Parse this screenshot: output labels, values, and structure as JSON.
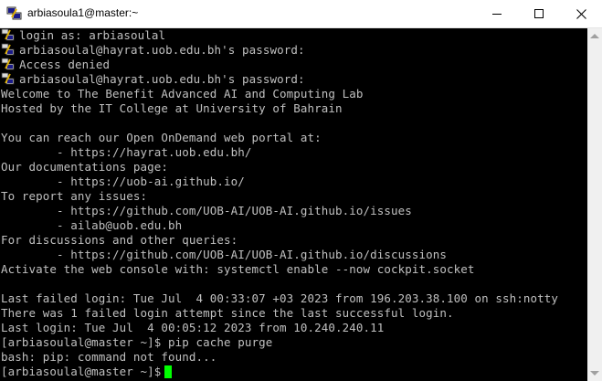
{
  "window": {
    "title": "arbiasoula1@master:~",
    "icon": "putty-terminal-icon"
  },
  "terminal": {
    "lines": [
      {
        "icon": true,
        "text": "login as: arbiasoulal"
      },
      {
        "icon": true,
        "text": "arbiasoulal@hayrat.uob.edu.bh's password:"
      },
      {
        "icon": true,
        "text": "Access denied"
      },
      {
        "icon": true,
        "text": "arbiasoulal@hayrat.uob.edu.bh's password:"
      },
      {
        "icon": false,
        "text": "Welcome to The Benefit Advanced AI and Computing Lab"
      },
      {
        "icon": false,
        "text": "Hosted by the IT College at University of Bahrain"
      },
      {
        "icon": false,
        "text": ""
      },
      {
        "icon": false,
        "text": "You can reach our Open OnDemand web portal at:"
      },
      {
        "icon": false,
        "text": "        - https://hayrat.uob.edu.bh/"
      },
      {
        "icon": false,
        "text": "Our documentations page:"
      },
      {
        "icon": false,
        "text": "        - https://uob-ai.github.io/"
      },
      {
        "icon": false,
        "text": "To report any issues:"
      },
      {
        "icon": false,
        "text": "        - https://github.com/UOB-AI/UOB-AI.github.io/issues"
      },
      {
        "icon": false,
        "text": "        - ailab@uob.edu.bh"
      },
      {
        "icon": false,
        "text": "For discussions and other queries:"
      },
      {
        "icon": false,
        "text": "        - https://github.com/UOB-AI/UOB-AI.github.io/discussions"
      },
      {
        "icon": false,
        "text": "Activate the web console with: systemctl enable --now cockpit.socket"
      },
      {
        "icon": false,
        "text": ""
      },
      {
        "icon": false,
        "text": "Last failed login: Tue Jul  4 00:33:07 +03 2023 from 196.203.38.100 on ssh:notty"
      },
      {
        "icon": false,
        "text": "There was 1 failed login attempt since the last successful login."
      },
      {
        "icon": false,
        "text": "Last login: Tue Jul  4 00:05:12 2023 from 10.240.240.11"
      },
      {
        "icon": false,
        "text": "[arbiasoulal@master ~]$ pip cache purge"
      },
      {
        "icon": false,
        "text": "bash: pip: command not found..."
      }
    ],
    "prompt": "[arbiasoulal@master ~]$",
    "colors": {
      "background": "#000000",
      "foreground": "#c0c0c0",
      "cursor": "#00ff00"
    }
  }
}
